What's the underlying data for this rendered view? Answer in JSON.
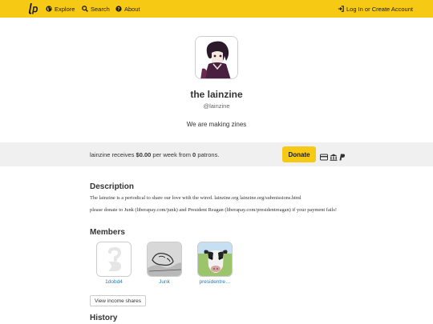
{
  "nav": {
    "logo_icon": "liberapay-logo-icon",
    "explore_label": "Explore",
    "search_label": "Search",
    "about_label": "About",
    "login_label": "Log In or Create Account"
  },
  "profile": {
    "name": "the lainzine",
    "handle": "@lainzine",
    "tagline": "We are making zines"
  },
  "receiving": {
    "prefix": "lainzine receives",
    "amount": "$0.00",
    "middle": "per week from",
    "patrons": "0",
    "suffix": "patrons.",
    "donate_label": "Donate",
    "payment_icons": [
      "credit-card-icon",
      "bank-icon",
      "paypal-icon"
    ]
  },
  "description": {
    "title": "Description",
    "line1": "The lainzine is a periodical to share our love with the wired. lainzine.org lainzine.org/submissions.html",
    "line2": "please donate to Junk (liberapay.com/junk) and President Reagan (liberapay.com/presidentreagan) if your payment fails!"
  },
  "members": {
    "title": "Members",
    "items": [
      {
        "name": "1dobd4"
      },
      {
        "name": "Junk"
      },
      {
        "name": "presidentre…"
      }
    ],
    "income_shares_label": "View income shares"
  },
  "history": {
    "title": "History"
  },
  "colors": {
    "brand_yellow": "#f6c915",
    "link_blue": "#2a7ab0"
  }
}
